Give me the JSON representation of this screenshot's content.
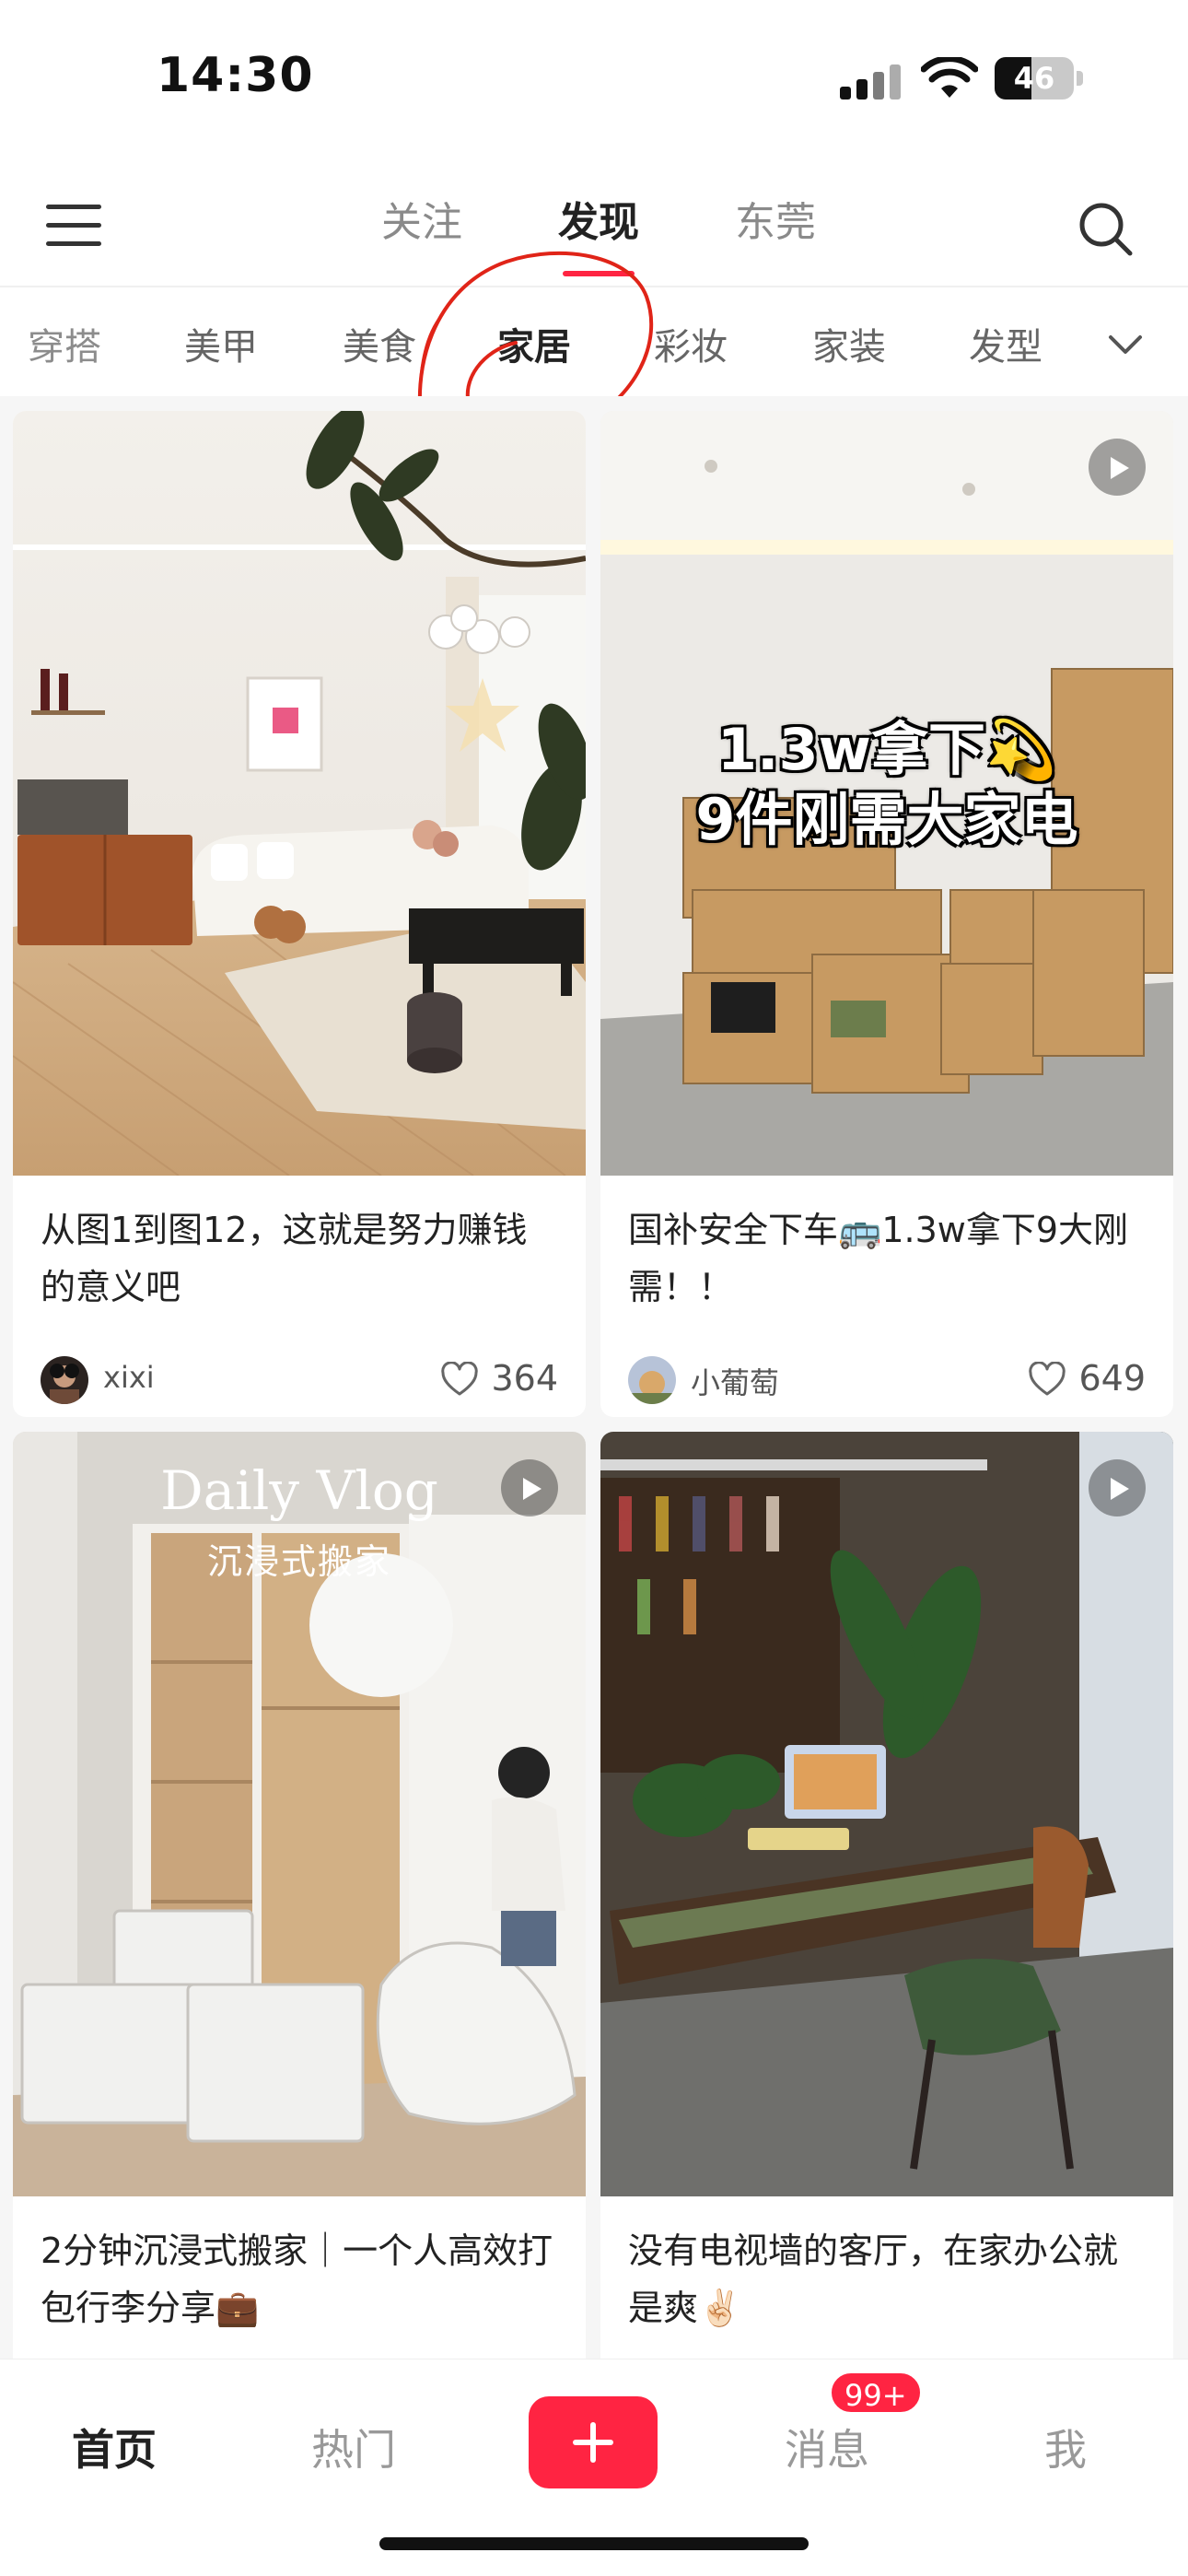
{
  "status_bar": {
    "time": "14:30",
    "battery_level": "46",
    "battery_fraction": 0.46
  },
  "top_nav": {
    "tabs": [
      {
        "label": "关注",
        "active": false
      },
      {
        "label": "发现",
        "active": true
      },
      {
        "label": "东莞",
        "active": false
      }
    ]
  },
  "categories": {
    "items": [
      "穿搭",
      "美甲",
      "美食",
      "家居",
      "彩妆",
      "家装",
      "发型"
    ],
    "selected": "家居"
  },
  "feed": [
    {
      "title": "从图1到图12，这就是努力赚钱的意义吧",
      "author": "xixi",
      "likes": "364",
      "video": false,
      "overlay_text": ""
    },
    {
      "title": "国补安全下车🚌1.3w拿下9大刚需！！",
      "author": "小葡萄",
      "likes": "649",
      "video": true,
      "overlay_text": "1.3w拿下💫\n9件刚需大家电"
    },
    {
      "title": "2分钟沉浸式搬家｜一个人高效打包行李分享💼",
      "author": "",
      "likes": "",
      "video": true,
      "overlay_text": "Daily Vlog",
      "overlay_sub": "沉浸式搬家"
    },
    {
      "title": "没有电视墙的客厅，在家办公就是爽✌🏻",
      "author": "",
      "likes": "",
      "video": true,
      "overlay_text": ""
    }
  ],
  "tab_bar": {
    "items": [
      {
        "label": "首页",
        "active": true
      },
      {
        "label": "热门",
        "active": false
      },
      {
        "label": "消息",
        "active": false,
        "badge": "99+"
      },
      {
        "label": "我",
        "active": false
      }
    ]
  },
  "colors": {
    "accent": "#ff2442",
    "annotation": "#e02418"
  }
}
